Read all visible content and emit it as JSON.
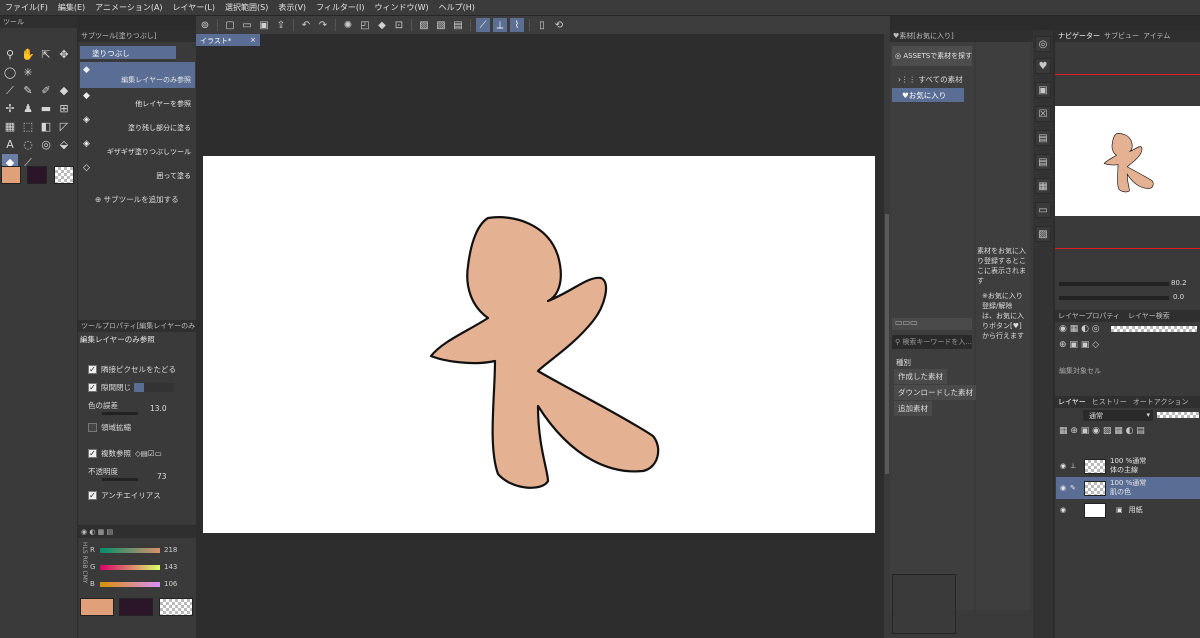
{
  "menu": [
    "ファイル(F)",
    "編集(E)",
    "アニメーション(A)",
    "レイヤー(L)",
    "選択範囲(S)",
    "表示(V)",
    "フィルター(I)",
    "ウィンドウ(W)",
    "ヘルプ(H)"
  ],
  "tool_panel": {
    "tab": "ツール"
  },
  "subtool_panel": {
    "tab": "サブツール[塗りつぶし]",
    "group": "塗りつぶし",
    "items": [
      "編集レイヤーのみ参照",
      "他レイヤーを参照",
      "塗り残し部分に塗る",
      "ギザギザ塗りつぶしツール",
      "囲って塗る"
    ],
    "add_label": "サブツールを追加する"
  },
  "tool_property": {
    "tab": "ツールプロパティ[編集レイヤーのみ",
    "title": "編集レイヤーのみ参照",
    "adjacent": "隣接ピクセルをたどる",
    "gap": "隙間閉じ",
    "color_margin_label": "色の誤差",
    "color_margin_value": "13.0",
    "area_scaling": "領域拡縮",
    "reference": "複数参照",
    "opacity_label": "不透明度",
    "opacity_value": "73",
    "antialias": "アンチエイリアス"
  },
  "color_slider": {
    "modes": "HLS RGB CMY",
    "r_label": "R",
    "r_value": "218",
    "g_label": "G",
    "g_value": "143",
    "b_label": "B",
    "b_value": "106"
  },
  "colors": {
    "main": "#e0a07a",
    "sub": "#2a1628",
    "accent": "#5a6d94",
    "skin": "#e5b193"
  },
  "canvas": {
    "tab": "イラスト*",
    "tab_close": "×"
  },
  "material": {
    "header": "素材[お気に入り]",
    "assets_button": "ASSETSで素材を探す",
    "all": "すべての素材",
    "favorites": "お気に入り",
    "search_placeholder": "検索キーワードを入...",
    "type_label": "種別",
    "types": [
      "作成した素材",
      "ダウンロードした素材",
      "追加素材"
    ],
    "hint": "素材をお気に入り登録するとここに表示されます",
    "hint2": "※お気に入り登録/解除は、お気に入りボタン[♥]から行えます"
  },
  "navigator": {
    "tabs": [
      "ナビゲーター",
      "サブビュー",
      "アイテム"
    ],
    "zoom": "80.2",
    "angle": "0.0"
  },
  "layer_property": {
    "tabs": [
      "レイヤープロパティ",
      "レイヤー検索"
    ],
    "target": "編集対象セル"
  },
  "layers": {
    "tabs": [
      "レイヤー",
      "ヒストリー",
      "オートアクション"
    ],
    "blend": "通常",
    "opacity": "100",
    "rows": [
      {
        "mode": "100 %通常",
        "name": "体の主線"
      },
      {
        "mode": "100 %通常",
        "name": "肌の色"
      },
      {
        "mode": "",
        "name": "用紙"
      }
    ]
  }
}
